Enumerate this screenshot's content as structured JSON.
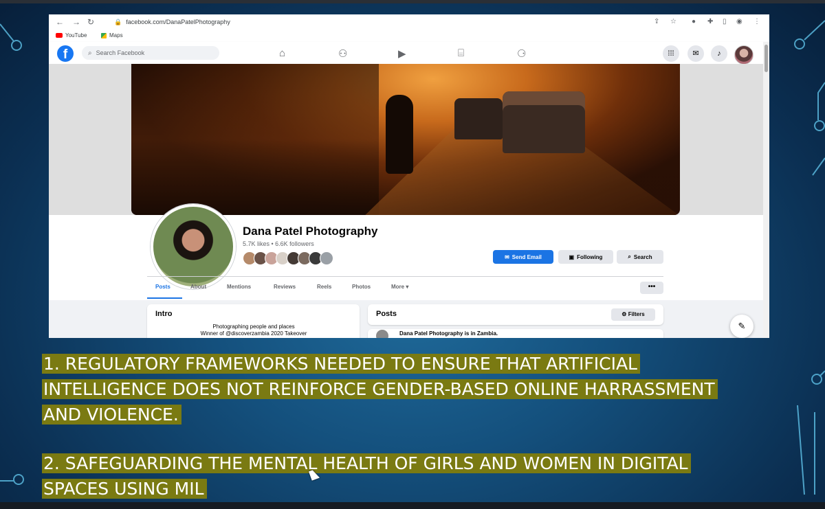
{
  "browser": {
    "url": "facebook.com/DanaPatelPhotography",
    "bookmarks": [
      "YouTube",
      "Maps"
    ]
  },
  "facebook": {
    "logo": "f",
    "search_placeholder": "Search Facebook",
    "nav_icons": [
      "home-icon",
      "friends-icon",
      "watch-icon",
      "marketplace-icon",
      "gaming-icon"
    ],
    "right_icons": [
      "menu-grid-icon",
      "messenger-icon",
      "notifications-icon"
    ]
  },
  "page": {
    "name": "Dana Patel Photography",
    "stats": "5.7K likes • 6.6K followers",
    "buttons": {
      "send_email": "Send Email",
      "following": "Following",
      "search": "Search"
    },
    "tabs": [
      "Posts",
      "About",
      "Mentions",
      "Reviews",
      "Reels",
      "Photos",
      "More"
    ],
    "active_tab": "Posts",
    "more_options": "•••"
  },
  "intro": {
    "title": "Intro",
    "lines": [
      "Photographing people and places",
      "Winner of @discoverzambia 2020 Takeover"
    ]
  },
  "posts": {
    "title": "Posts",
    "filters_label": "Filters",
    "first_post_preview": "Dana Patel Photography is in Zambia."
  },
  "captions": {
    "point1": [
      "1. REGULATORY FRAMEWORKS NEEDED TO ENSURE THAT ARTIFICIAL",
      "INTELLIGENCE DOES NOT REINFORCE GENDER-BASED ONLINE HARRASSMENT",
      "AND VIOLENCE."
    ],
    "point2": [
      "2. SAFEGUARDING THE MENTAL HEALTH OF GIRLS AND WOMEN IN DIGITAL",
      "SPACES USING MIL"
    ]
  },
  "colors": {
    "fb_blue": "#1877f2",
    "highlight": "#7a7a12"
  }
}
